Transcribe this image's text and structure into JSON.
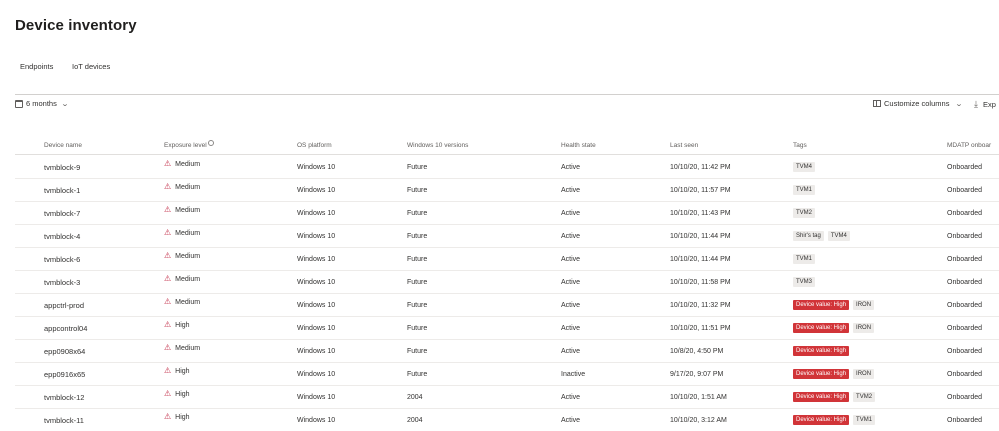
{
  "page": {
    "title": "Device inventory"
  },
  "tabs": [
    {
      "label": "Endpoints"
    },
    {
      "label": "IoT devices"
    }
  ],
  "toolbar": {
    "period_label": "6 months",
    "customize_columns_label": "Customize columns",
    "export_label": "Exp"
  },
  "table": {
    "headers": [
      "Device name",
      "Exposure level",
      "OS platform",
      "Windows 10 versions",
      "Health state",
      "Last seen",
      "Tags",
      "MDATP onboar"
    ],
    "rows": [
      {
        "name": "tvmblock-9",
        "exposure": "Medium",
        "os": "Windows 10",
        "version": "Future",
        "health": "Active",
        "last_seen": "10/10/20, 11:42 PM",
        "tags": [
          "TVM4"
        ],
        "onboard": "Onboarded"
      },
      {
        "name": "tvmblock-1",
        "exposure": "Medium",
        "os": "Windows 10",
        "version": "Future",
        "health": "Active",
        "last_seen": "10/10/20, 11:57 PM",
        "tags": [
          "TVM1"
        ],
        "onboard": "Onboarded"
      },
      {
        "name": "tvmblock-7",
        "exposure": "Medium",
        "os": "Windows 10",
        "version": "Future",
        "health": "Active",
        "last_seen": "10/10/20, 11:43 PM",
        "tags": [
          "TVM2"
        ],
        "onboard": "Onboarded"
      },
      {
        "name": "tvmblock-4",
        "exposure": "Medium",
        "os": "Windows 10",
        "version": "Future",
        "health": "Active",
        "last_seen": "10/10/20, 11:44 PM",
        "tags": [
          "Shir's tag",
          "TVM4"
        ],
        "onboard": "Onboarded"
      },
      {
        "name": "tvmblock-6",
        "exposure": "Medium",
        "os": "Windows 10",
        "version": "Future",
        "health": "Active",
        "last_seen": "10/10/20, 11:44 PM",
        "tags": [
          "TVM1"
        ],
        "onboard": "Onboarded"
      },
      {
        "name": "tvmblock-3",
        "exposure": "Medium",
        "os": "Windows 10",
        "version": "Future",
        "health": "Active",
        "last_seen": "10/10/20, 11:58 PM",
        "tags": [
          "TVM3"
        ],
        "onboard": "Onboarded"
      },
      {
        "name": "appctrl-prod",
        "exposure": "Medium",
        "os": "Windows 10",
        "version": "Future",
        "health": "Active",
        "last_seen": "10/10/20, 11:32 PM",
        "tags": [
          "Device value: High",
          "IRON"
        ],
        "onboard": "Onboarded"
      },
      {
        "name": "appcontrol04",
        "exposure": "High",
        "os": "Windows 10",
        "version": "Future",
        "health": "Active",
        "last_seen": "10/10/20, 11:51 PM",
        "tags": [
          "Device value: High",
          "IRON"
        ],
        "onboard": "Onboarded"
      },
      {
        "name": "epp0908x64",
        "exposure": "Medium",
        "os": "Windows 10",
        "version": "Future",
        "health": "Active",
        "last_seen": "10/8/20, 4:50 PM",
        "tags": [
          "Device value: High"
        ],
        "onboard": "Onboarded"
      },
      {
        "name": "epp0916x65",
        "exposure": "High",
        "os": "Windows 10",
        "version": "Future",
        "health": "Inactive",
        "last_seen": "9/17/20, 9:07 PM",
        "tags": [
          "Device value: High",
          "IRON"
        ],
        "onboard": "Onboarded"
      },
      {
        "name": "tvmblock-12",
        "exposure": "High",
        "os": "Windows 10",
        "version": "2004",
        "health": "Active",
        "last_seen": "10/10/20, 1:51 AM",
        "tags": [
          "Device value: High",
          "TVM2"
        ],
        "onboard": "Onboarded"
      },
      {
        "name": "tvmblock-11",
        "exposure": "High",
        "os": "Windows 10",
        "version": "2004",
        "health": "Active",
        "last_seen": "10/10/20, 3:12 AM",
        "tags": [
          "Device value: High",
          "TVM1"
        ],
        "onboard": "Onboarded"
      }
    ]
  },
  "colors": {
    "warning": "#c4314b",
    "tag_high": "#d13438",
    "tag_gray": "#edebe9"
  },
  "icons": {
    "warning": "warning-triangle-icon",
    "calendar": "calendar-icon",
    "columns": "columns-icon",
    "download": "download-icon",
    "info": "info-icon",
    "chevron": "chevron-down-icon"
  }
}
